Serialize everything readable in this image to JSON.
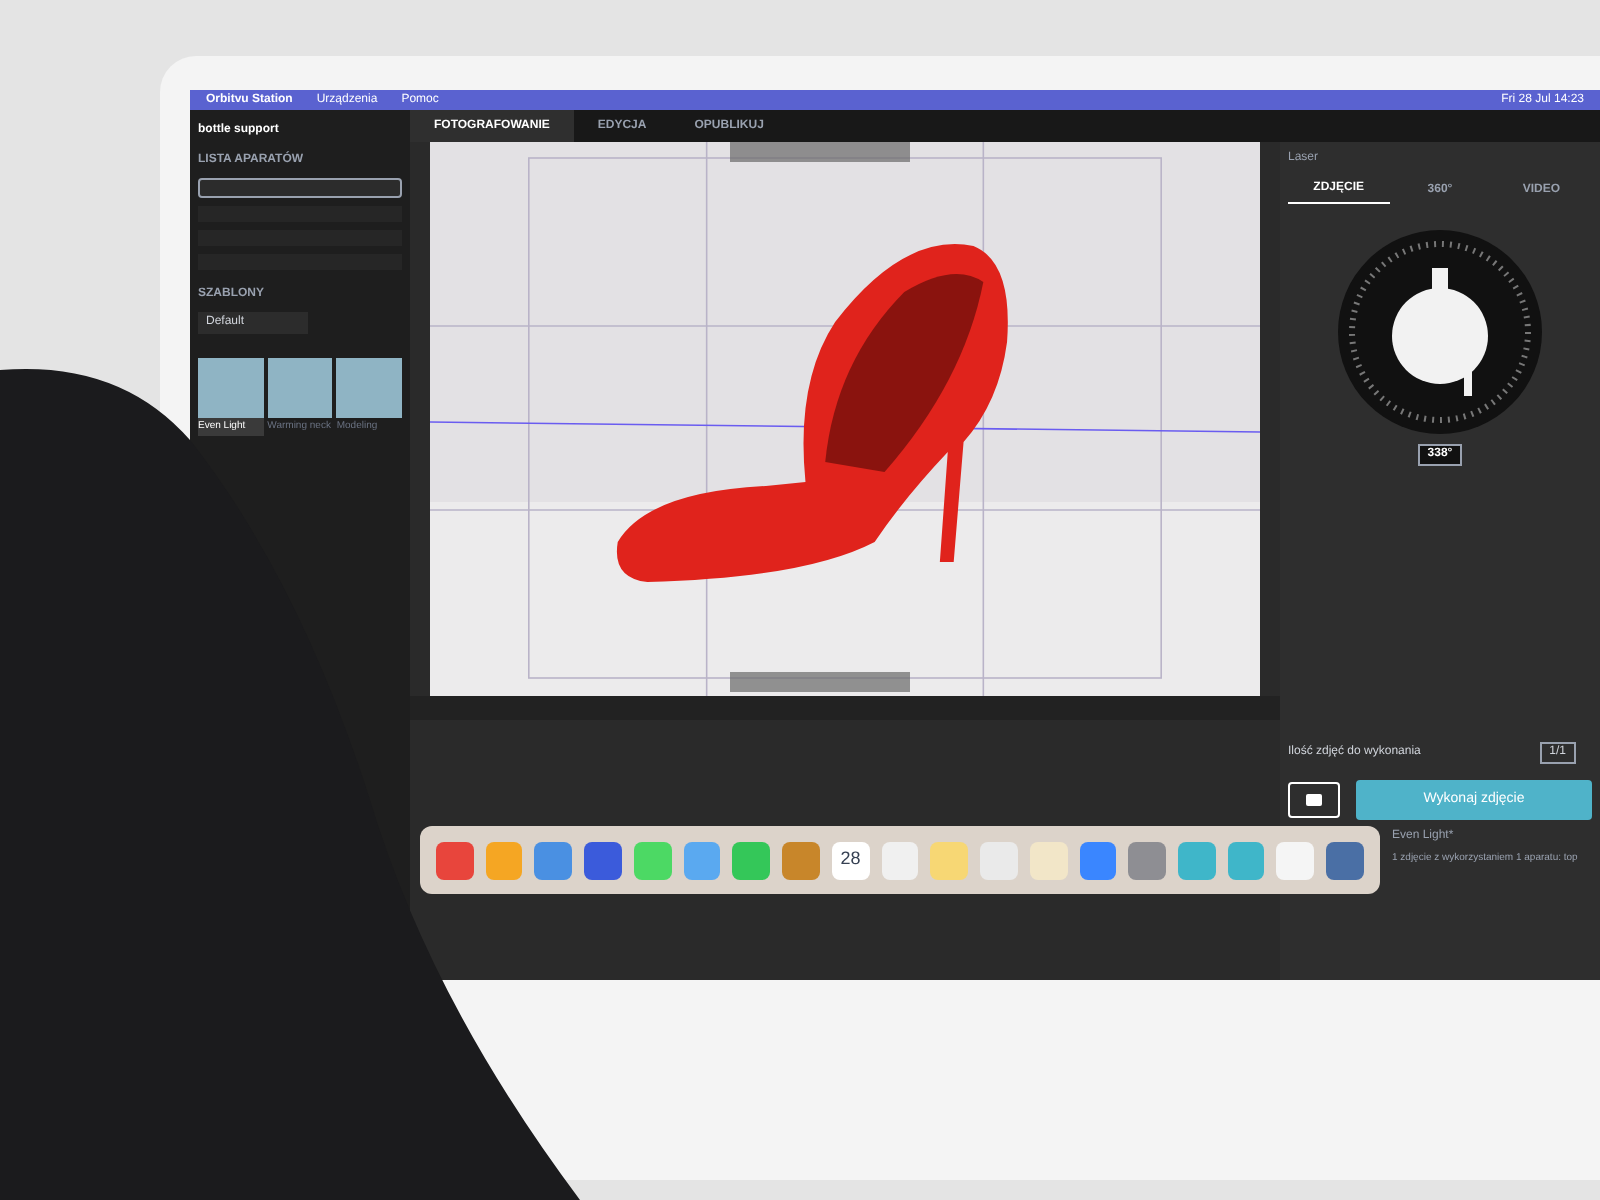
{
  "menu_bar": {
    "items": [
      "Orbitvu Station",
      "Urządzenia",
      "Pomoc"
    ],
    "clock": "Fri 28 Jul 14:23"
  },
  "left_panel": {
    "title": "bottle support",
    "cameras_heading": "LISTA APARATÓW",
    "cameras": [
      {
        "selected": true
      },
      {
        "selected": false
      },
      {
        "selected": false
      },
      {
        "selected": false
      }
    ],
    "templates_heading": "SZABLONY",
    "folder": "Default",
    "templates": [
      {
        "label": "Even Light",
        "selected": true
      },
      {
        "label": "Warming neck",
        "selected": false
      },
      {
        "label": "Modeling",
        "selected": false
      }
    ]
  },
  "main_tabs": [
    {
      "label": "FOTOGRAFOWANIE",
      "selected": true
    },
    {
      "label": "EDYCJA",
      "selected": false
    },
    {
      "label": "OPUBLIKUJ",
      "selected": false
    }
  ],
  "right_panel": {
    "laser": "Laser",
    "tabs": [
      {
        "label": "ZDJĘCIE",
        "selected": true
      },
      {
        "label": "360°",
        "selected": false
      },
      {
        "label": "VIDEO",
        "selected": false
      }
    ],
    "angle": "338°",
    "count_label": "Ilość zdjęć do wykonania",
    "counter": "1/1",
    "shoot_button": "Wykonaj zdjęcie",
    "template": "Even Light*",
    "summary": "1 zdjęcie z wykorzystaniem 1 aparatu: top"
  },
  "dock": [
    {
      "color": "#e8453c"
    },
    {
      "color": "#f5a623"
    },
    {
      "color": "#4a90e2"
    },
    {
      "color": "#3b5bdb"
    },
    {
      "color": "#4cd964"
    },
    {
      "color": "#5aa9f0"
    },
    {
      "color": "#34c759"
    },
    {
      "color": "#c8862a"
    },
    {
      "color": "#ffffff",
      "label": "28"
    },
    {
      "color": "#f0f0f0"
    },
    {
      "color": "#f7d774"
    },
    {
      "color": "#eaeaea"
    },
    {
      "color": "#f2e6c8"
    },
    {
      "color": "#3a86ff"
    },
    {
      "color": "#8e8e93"
    },
    {
      "color": "#3fb6c9"
    },
    {
      "color": "#3fb6c9"
    },
    {
      "color": "#f5f5f5"
    },
    {
      "color": "#4a6fa5"
    }
  ]
}
